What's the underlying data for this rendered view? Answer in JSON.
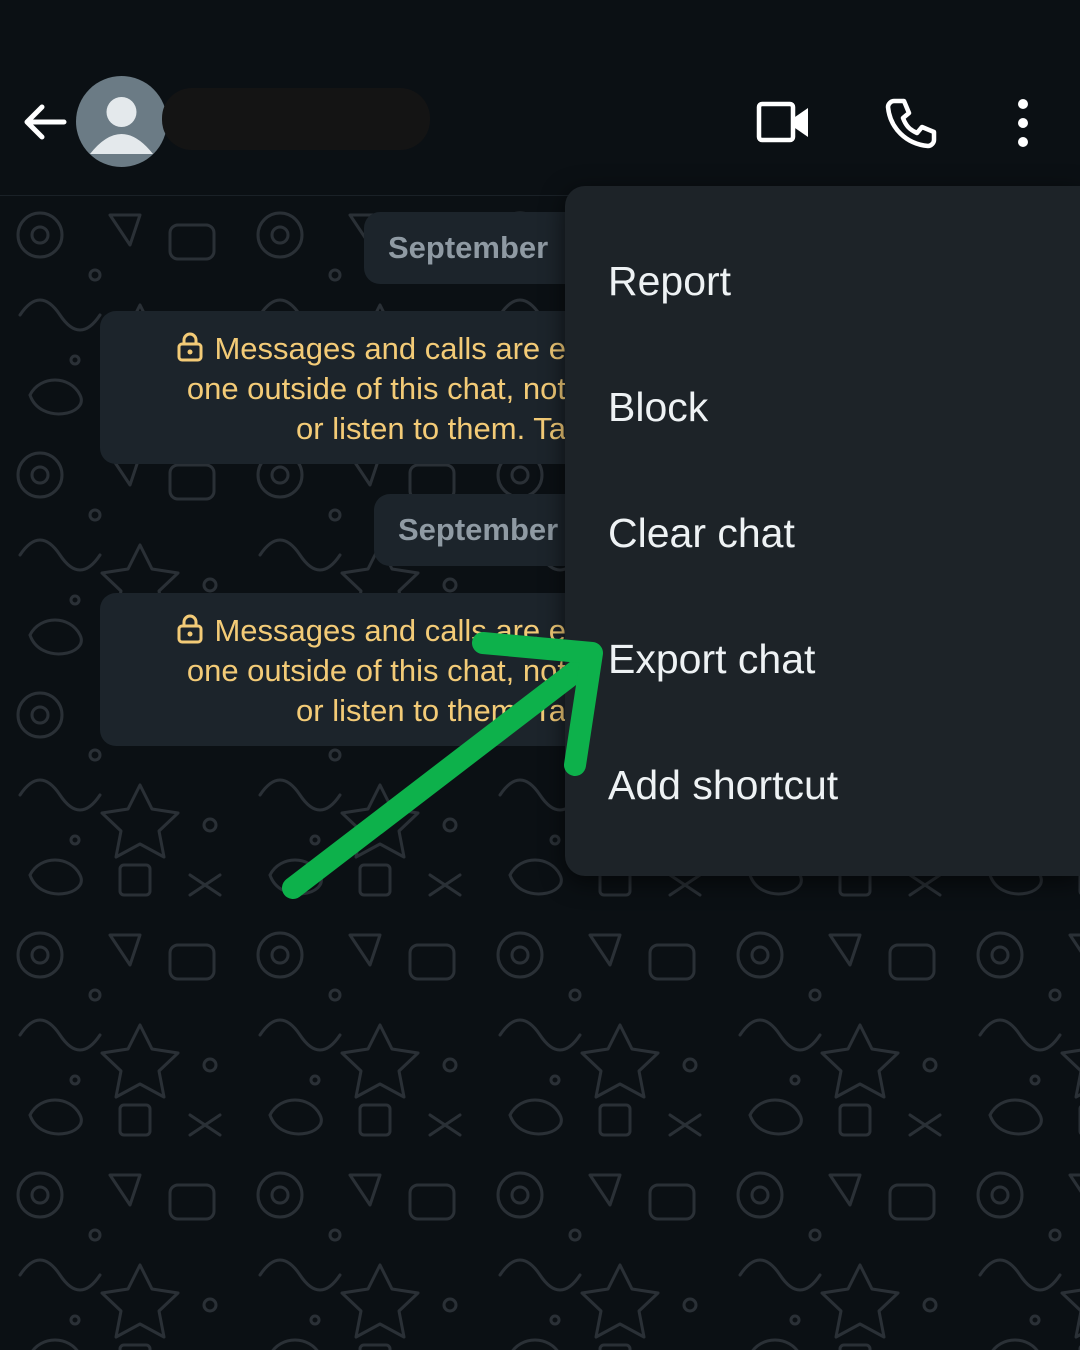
{
  "header": {
    "contact_name": "",
    "icons": [
      "back-arrow-icon",
      "avatar-placeholder-icon",
      "video-call-icon",
      "phone-call-icon",
      "more-vert-icon"
    ]
  },
  "chat": {
    "date_chips": [
      "September",
      "September"
    ],
    "encryption_notices": [
      {
        "line1": "Messages and calls are e",
        "line2": "one outside of this chat, not",
        "line3": "or listen to them. Ta"
      },
      {
        "line1": "Messages and calls are e",
        "line2": "one outside of this chat, not",
        "line3": "or listen to them. Ta"
      }
    ]
  },
  "menu": {
    "items": [
      {
        "label": "Report"
      },
      {
        "label": "Block"
      },
      {
        "label": "Clear chat"
      },
      {
        "label": "Export chat"
      },
      {
        "label": "Add shortcut"
      }
    ]
  },
  "annotation": {
    "type": "green-arrow",
    "points_to": "Export chat",
    "color": "#0db14b"
  },
  "colors": {
    "background": "#0b1014",
    "bubble": "#1c242b",
    "menu": "#1d2328",
    "notice_text": "#f3cb77",
    "date_text": "#8f9aa3",
    "menu_text": "#eef2f4"
  }
}
